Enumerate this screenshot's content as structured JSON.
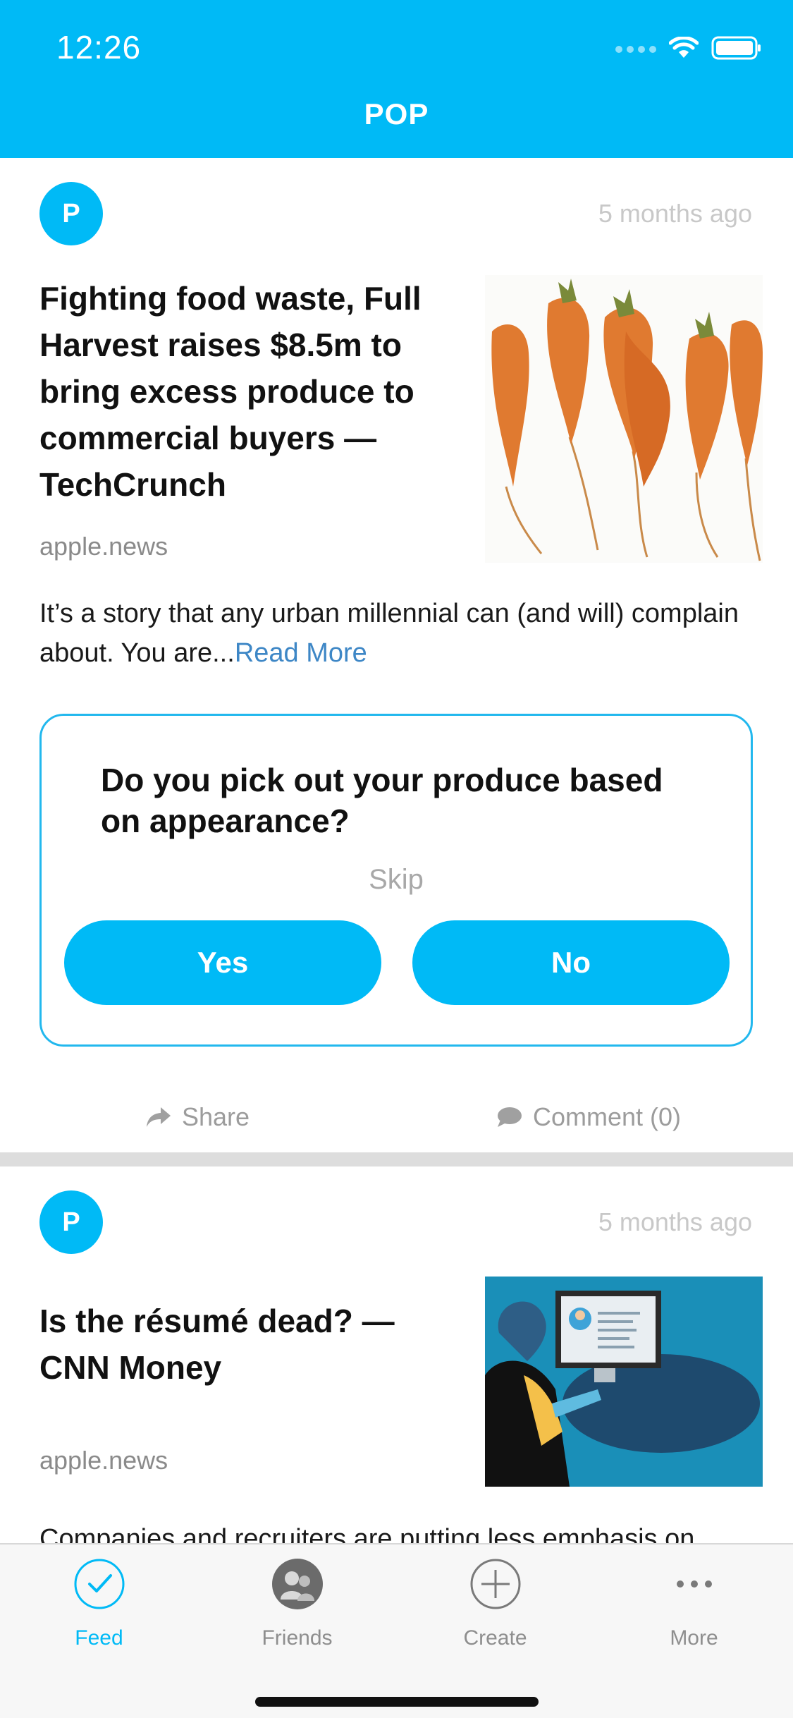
{
  "status_bar": {
    "time": "12:26"
  },
  "header": {
    "title": "POP"
  },
  "posts": [
    {
      "avatar_letter": "P",
      "timestamp": "5 months ago",
      "title": "Fighting food waste, Full Harvest raises $8.5m to bring excess produce to commercial buyers — TechCrunch",
      "source": "apple.news",
      "excerpt": "It’s a story that any urban millennial can (and will) complain about. You are...",
      "read_more": "Read More",
      "thumbnail_icon": "carrots-photo",
      "poll": {
        "question": "Do you pick out your produce based on appearance?",
        "skip_label": "Skip",
        "yes_label": "Yes",
        "no_label": "No"
      },
      "share_label": "Share",
      "comment_label": "Comment (0)"
    },
    {
      "avatar_letter": "P",
      "timestamp": "5 months ago",
      "title": "Is the résumé dead? — CNN Money",
      "source": "apple.news",
      "excerpt": "Companies and recruiters are putting less emphasis on",
      "thumbnail_icon": "resume-illustration"
    }
  ],
  "tabbar": {
    "items": [
      {
        "label": "Feed",
        "icon": "checkmark-circle-icon",
        "active": true
      },
      {
        "label": "Friends",
        "icon": "friends-icon",
        "active": false
      },
      {
        "label": "Create",
        "icon": "plus-circle-icon",
        "active": false
      },
      {
        "label": "More",
        "icon": "ellipsis-icon",
        "active": false
      }
    ]
  },
  "colors": {
    "brand": "#00BAF6",
    "link": "#3E87C6",
    "muted": "#8E8E8E"
  }
}
